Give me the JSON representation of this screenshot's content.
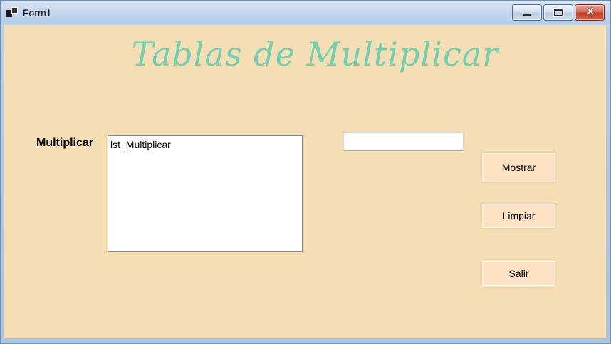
{
  "window": {
    "title": "Form1",
    "app_icon": "app-window-icon",
    "controls": {
      "minimize": "minimize-icon",
      "maximize": "maximize-icon",
      "close": "close-icon",
      "close_glyph": "✕"
    }
  },
  "colors": {
    "form_background": "#f5deb3",
    "heading": "#6fd1b0",
    "button_background": "#fde3c3"
  },
  "form": {
    "heading": "Tablas de Multiplicar",
    "multiplicar_label": "Multiplicar",
    "listbox": {
      "items": [
        "lst_Multiplicar"
      ]
    },
    "textbox": {
      "value": ""
    },
    "buttons": {
      "mostrar": "Mostrar",
      "limpiar": "Limpiar",
      "salir": "Salir"
    }
  }
}
